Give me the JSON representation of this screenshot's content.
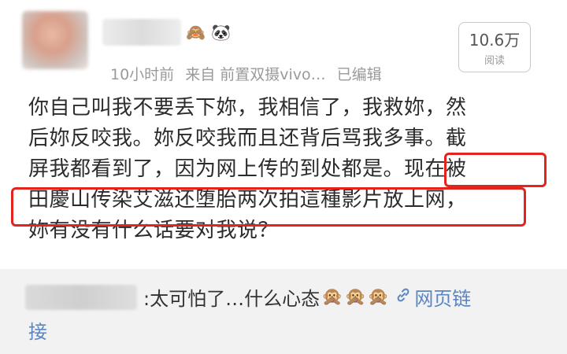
{
  "post": {
    "username": "",
    "badges": [
      "🙈",
      "🐼"
    ],
    "meta": {
      "time": "10小时前",
      "source_prefix": "来自",
      "source": "前置双摄vivo…",
      "edited": "已编辑"
    },
    "reads": {
      "count": "10.6万",
      "label": "阅读"
    },
    "content_lines": [
      "你自己叫我不要丢下妳，我相信了，我救妳，然",
      "后妳反咬我。妳反咬我而且还背后骂我多事。截",
      "屏我都看到了，因为网上传的到处都是。现在被",
      "田慶山传染艾滋还堕胎两次拍這種影片放上网，",
      "妳有没有什么话要对我说？"
    ]
  },
  "comment": {
    "username": "",
    "text": ":太可怕了…什么心态",
    "emojis": [
      "🙊",
      "🙊",
      "🙊"
    ],
    "link_label_1": "网页链",
    "link_label_2": "接"
  },
  "colors": {
    "highlight": "#e3231d",
    "link": "#5b86c4",
    "meta": "#9a9a9a"
  }
}
